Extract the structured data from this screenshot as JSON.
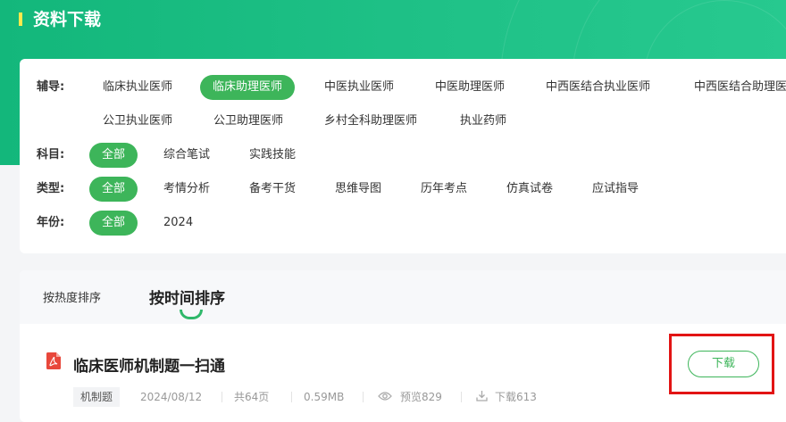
{
  "header": {
    "title": "资料下载"
  },
  "filters": {
    "coaching": {
      "label": "辅导:",
      "options": [
        "临床执业医师",
        "临床助理医师",
        "中医执业医师",
        "中医助理医师",
        "中西医结合执业医师",
        "中西医结合助理医师",
        "公卫执业医师",
        "公卫助理医师",
        "乡村全科助理医师",
        "执业药师"
      ],
      "active": "临床助理医师"
    },
    "subject": {
      "label": "科目:",
      "options": [
        "全部",
        "综合笔试",
        "实践技能"
      ],
      "active": "全部"
    },
    "type": {
      "label": "类型:",
      "options": [
        "全部",
        "考情分析",
        "备考干货",
        "思维导图",
        "历年考点",
        "仿真试卷",
        "应试指导"
      ],
      "active": "全部"
    },
    "year": {
      "label": "年份:",
      "options": [
        "全部",
        "2024"
      ],
      "active": "全部"
    }
  },
  "sort": {
    "tabs": [
      "按热度排序",
      "按时间排序"
    ],
    "active": "按时间排序"
  },
  "items": [
    {
      "icon": "pdf-icon",
      "title": "临床医师机制题一扫通",
      "tag": "机制题",
      "date": "2024/08/12",
      "pages": "共64页",
      "size": "0.59MB",
      "preview": "预览829",
      "downloads": "下载613",
      "download_label": "下载"
    }
  ],
  "colors": {
    "brand_green": "#3db55a",
    "header_green": "#1fc187",
    "highlight_red": "#e21414"
  }
}
